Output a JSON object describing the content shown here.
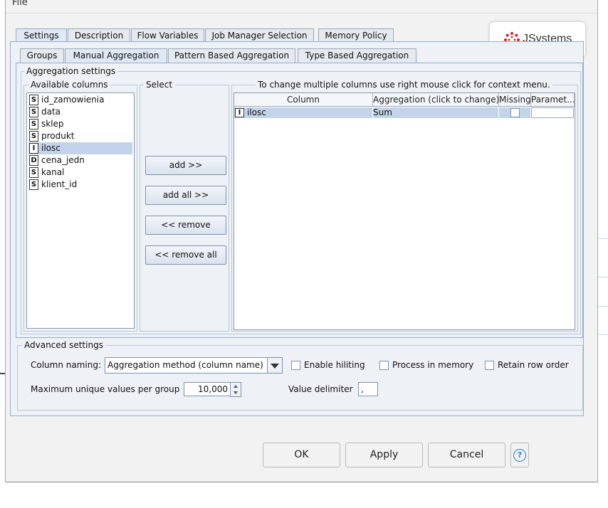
{
  "menu": {
    "file": "File"
  },
  "logo": {
    "text": "JSystems",
    "accent": "#d0202a"
  },
  "tabs": [
    "Settings",
    "Description",
    "Flow Variables",
    "Job Manager Selection",
    "Memory Policy"
  ],
  "subtabs": [
    "Groups",
    "Manual Aggregation",
    "Pattern Based Aggregation",
    "Type Based Aggregation"
  ],
  "aggregation": {
    "legend": "Aggregation settings",
    "available_legend": "Available columns",
    "select_legend": "Select",
    "hint": "To change multiple columns use right mouse click for context menu.",
    "columns": [
      {
        "type": "S",
        "name": "id_zamowienia"
      },
      {
        "type": "S",
        "name": "data"
      },
      {
        "type": "S",
        "name": "sklep"
      },
      {
        "type": "S",
        "name": "produkt"
      },
      {
        "type": "I",
        "name": "ilosc"
      },
      {
        "type": "D",
        "name": "cena_jedn"
      },
      {
        "type": "S",
        "name": "kanal"
      },
      {
        "type": "S",
        "name": "klient_id"
      }
    ],
    "buttons": {
      "add": "add >>",
      "add_all": "add all >>",
      "remove": "<< remove",
      "remove_all": "<< remove all"
    },
    "table": {
      "headers": [
        "Column",
        "Aggregation (click to change)",
        "Missing",
        "Paramet..."
      ],
      "rows": [
        {
          "type": "I",
          "column": "ilosc",
          "aggregation": "Sum"
        }
      ]
    }
  },
  "advanced": {
    "legend": "Advanced settings",
    "column_naming_label": "Column naming:",
    "column_naming_value": "Aggregation method (column name)",
    "enable_hiliting": "Enable hiliting",
    "process_in_memory": "Process in memory",
    "retain_row_order": "Retain row order",
    "max_unique_label": "Maximum unique values per group",
    "max_unique_value": "10,000",
    "value_delimiter_label": "Value delimiter",
    "value_delimiter_value": ","
  },
  "footer": {
    "ok": "OK",
    "apply": "Apply",
    "cancel": "Cancel",
    "help": "?"
  },
  "colors": {
    "panel_border": "#8fb0d4",
    "selection": "#c3d4ea",
    "help": "#2a7fd4"
  }
}
